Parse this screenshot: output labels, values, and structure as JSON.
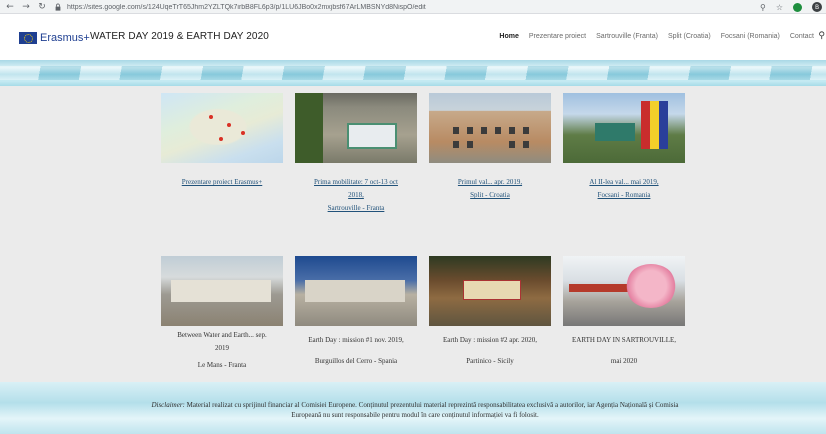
{
  "browser": {
    "url": "https://sites.google.com/s/124UqeTrT65Jhm2YZLTQk7irbB8FL6p3/p/1LU6JBo0x2mxjbsf67ArLMBSNYd8NispO/edit",
    "profile_initial": "B"
  },
  "site": {
    "brand": "Erasmus+",
    "title": "WATER DAY 2019 & EARTH DAY 2020",
    "nav": [
      "Home",
      "Prezentare proiect",
      "Sartrouville (Franta)",
      "Split (Croatia)",
      "Focsani (Romania)",
      "Contact"
    ]
  },
  "cards": [
    {
      "lines": [
        "Prezentare proiect Erasmus+"
      ],
      "link": true
    },
    {
      "lines": [
        "Prima mobilitate: 7 oct-13 oct",
        "2018,",
        "Sartrouville - Franta"
      ],
      "link": true
    },
    {
      "lines": [
        "Primul val... apr. 2019,",
        "Split - Croatia"
      ],
      "link": true
    },
    {
      "lines": [
        "Al II-lea val... mai 2019,",
        "Focsani - Romania"
      ],
      "link": true
    },
    {
      "lines": [
        "Between Water and Earth... sep.",
        "2019",
        "Le Mans - Franta"
      ],
      "link": false
    },
    {
      "lines": [
        "Earth Day : mission #1 nov. 2019,",
        "Burguillos del Cerro - Spania"
      ],
      "link": false
    },
    {
      "lines": [
        "Earth Day : mission #2 apr. 2020,",
        "Partinico - Sicily"
      ],
      "link": false
    },
    {
      "lines": [
        "EARTH DAY IN SARTROUVILLE,",
        "mai 2020"
      ],
      "link": false
    }
  ],
  "disclaimer": {
    "label": "Disclaimer:",
    "text": " Material realizat cu sprijinul financiar al Comisiei Europene. Conținutul prezentului material reprezintă responsabilitatea exclusivă a autorilor, iar Agenția Națională și Comisia Europeană nu sunt responsabile pentru modul în care conținutul informației va fi folosit."
  }
}
